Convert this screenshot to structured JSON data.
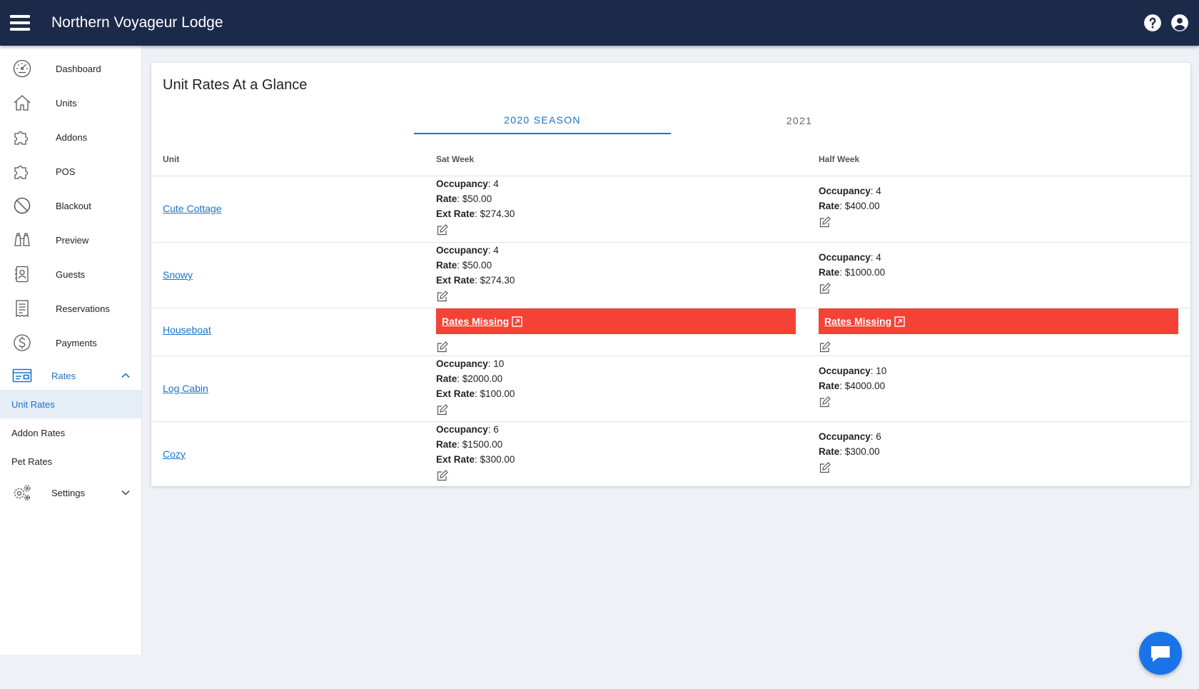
{
  "app": {
    "title": "Northern Voyageur Lodge"
  },
  "topbar": {
    "help_icon": "help-icon",
    "account_icon": "account-icon"
  },
  "sidebar": {
    "items": [
      {
        "label": "Dashboard",
        "icon": "dashboard-icon"
      },
      {
        "label": "Units",
        "icon": "home-icon"
      },
      {
        "label": "Addons",
        "icon": "puzzle-icon"
      },
      {
        "label": "POS",
        "icon": "puzzle-icon"
      },
      {
        "label": "Blackout",
        "icon": "block-icon"
      },
      {
        "label": "Preview",
        "icon": "binoculars-icon"
      },
      {
        "label": "Guests",
        "icon": "contact-book-icon"
      },
      {
        "label": "Reservations",
        "icon": "receipt-icon"
      },
      {
        "label": "Payments",
        "icon": "dollar-icon"
      }
    ],
    "rates": {
      "label": "Rates",
      "icon": "rates-card-icon",
      "expanded": true,
      "sub_items": [
        "Unit Rates",
        "Addon Rates",
        "Pet Rates"
      ],
      "active_sub": "Unit Rates"
    },
    "settings": {
      "label": "Settings",
      "icon": "gears-icon"
    }
  },
  "main": {
    "title": "Unit Rates At a Glance",
    "tabs": [
      {
        "label": "2020 SEASON",
        "active": true
      },
      {
        "label": "2021",
        "active": false
      }
    ],
    "columns": [
      "Unit",
      "Sat Week",
      "Half Week"
    ],
    "field_labels": {
      "occupancy": "Occupancy",
      "rate": "Rate",
      "ext_rate": "Ext Rate"
    },
    "rates_missing_label": "Rates Missing",
    "rows": [
      {
        "unit": "Cute Cottage",
        "sat": {
          "occupancy": "4",
          "rate": "$50.00",
          "ext_rate": "$274.30"
        },
        "half": {
          "occupancy": "4",
          "rate": "$400.00"
        }
      },
      {
        "unit": "Snowy",
        "sat": {
          "occupancy": "4",
          "rate": "$50.00",
          "ext_rate": "$274.30"
        },
        "half": {
          "occupancy": "4",
          "rate": "$1000.00"
        }
      },
      {
        "unit": "Houseboat",
        "sat": {
          "missing": true
        },
        "half": {
          "missing": true
        }
      },
      {
        "unit": "Log Cabin",
        "sat": {
          "occupancy": "10",
          "rate": "$2000.00",
          "ext_rate": "$100.00"
        },
        "half": {
          "occupancy": "10",
          "rate": "$4000.00"
        }
      },
      {
        "unit": "Cozy",
        "sat": {
          "occupancy": "6",
          "rate": "$1500.00",
          "ext_rate": "$300.00"
        },
        "half": {
          "occupancy": "6",
          "rate": "$300.00"
        }
      }
    ]
  },
  "chat": {
    "icon": "chat-icon"
  },
  "colors": {
    "topbar": "#1c2a4a",
    "accent": "#1a73c8",
    "alert": "#f44336"
  }
}
